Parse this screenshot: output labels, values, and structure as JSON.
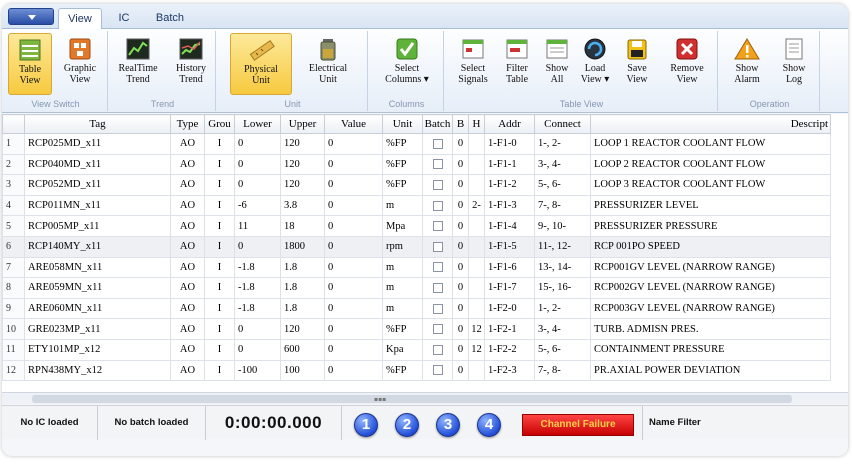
{
  "tabs": [
    "View",
    "IC",
    "Batch"
  ],
  "ribbon": {
    "groups": [
      {
        "label": "View Switch",
        "buttons": [
          {
            "label": "Table\nView",
            "icon": "table-view-icon"
          },
          {
            "label": "Graphic\nView",
            "icon": "graphic-view-icon"
          }
        ]
      },
      {
        "label": "Trend",
        "buttons": [
          {
            "label": "RealTime\nTrend",
            "icon": "realtime-trend-icon"
          },
          {
            "label": "History\nTrend",
            "icon": "history-trend-icon"
          }
        ]
      },
      {
        "label": "Unit",
        "buttons": [
          {
            "label": "Physical\nUnit",
            "icon": "ruler-icon"
          },
          {
            "label": "Electrical\nUnit",
            "icon": "battery-icon"
          }
        ]
      },
      {
        "label": "Columns",
        "buttons": [
          {
            "label": "Select\nColumns ▾",
            "icon": "checkmark-icon"
          }
        ]
      },
      {
        "label": "Table View",
        "buttons": [
          {
            "label": "Select\nSignals",
            "icon": "select-signals-icon"
          },
          {
            "label": "Filter\nTable",
            "icon": "filter-table-icon"
          },
          {
            "label": "Show\nAll",
            "icon": "show-all-icon"
          },
          {
            "label": "Load\nView ▾",
            "icon": "load-view-icon"
          },
          {
            "label": "Save\nView",
            "icon": "save-view-icon"
          },
          {
            "label": "Remove\nView",
            "icon": "remove-view-icon"
          }
        ]
      },
      {
        "label": "Operation",
        "buttons": [
          {
            "label": "Show\nAlarm",
            "icon": "alarm-icon"
          },
          {
            "label": "Show\nLog",
            "icon": "log-icon"
          }
        ]
      }
    ]
  },
  "table": {
    "headers": [
      "",
      "Tag",
      "Type",
      "Grou",
      "Lower",
      "Upper",
      "Value",
      "Unit",
      "Batch",
      "B",
      "H",
      "Addr",
      "Connect",
      "Descript"
    ],
    "rows": [
      [
        "1",
        "RCP025MD_x11",
        "AO",
        "I",
        "0",
        "120",
        "0",
        "%FP",
        "",
        "0",
        "",
        "1-F1-0",
        "1-, 2-",
        "LOOP 1 REACTOR COOLANT FLOW"
      ],
      [
        "2",
        "RCP040MD_x11",
        "AO",
        "I",
        "0",
        "120",
        "0",
        "%FP",
        "",
        "0",
        "",
        "1-F1-1",
        "3-, 4-",
        "LOOP 2 REACTOR COOLANT FLOW"
      ],
      [
        "3",
        "RCP052MD_x11",
        "AO",
        "I",
        "0",
        "120",
        "0",
        "%FP",
        "",
        "0",
        "",
        "1-F1-2",
        "5-, 6-",
        "LOOP 3 REACTOR COOLANT FLOW"
      ],
      [
        "4",
        "RCP011MN_x11",
        "AO",
        "I",
        "-6",
        "3.8",
        "0",
        "m",
        "",
        "0",
        "2-",
        "1-F1-3",
        "7-, 8-",
        "PRESSURIZER LEVEL"
      ],
      [
        "5",
        "RCP005MP_x11",
        "AO",
        "I",
        "11",
        "18",
        "0",
        "Mpa",
        "",
        "0",
        "",
        "1-F1-4",
        "9-, 10-",
        "PRESSURIZER PRESSURE"
      ],
      [
        "6",
        "RCP140MY_x11",
        "AO",
        "I",
        "0",
        "1800",
        "0",
        "rpm",
        "",
        "0",
        "",
        "1-F1-5",
        "11-, 12-",
        "RCP 001PO SPEED"
      ],
      [
        "7",
        "ARE058MN_x11",
        "AO",
        "I",
        "-1.8",
        "1.8",
        "0",
        "m",
        "",
        "0",
        "",
        "1-F1-6",
        "13-, 14-",
        "RCP001GV LEVEL (NARROW RANGE)"
      ],
      [
        "8",
        "ARE059MN_x11",
        "AO",
        "I",
        "-1.8",
        "1.8",
        "0",
        "m",
        "",
        "0",
        "",
        "1-F1-7",
        "15-, 16-",
        "RCP002GV LEVEL (NARROW RANGE)"
      ],
      [
        "9",
        "ARE060MN_x11",
        "AO",
        "I",
        "-1.8",
        "1.8",
        "0",
        "m",
        "",
        "0",
        "",
        "1-F2-0",
        "1-, 2-",
        "RCP003GV LEVEL (NARROW RANGE)"
      ],
      [
        "10",
        "GRE023MP_x11",
        "AO",
        "I",
        "0",
        "120",
        "0",
        "%FP",
        "",
        "0",
        "12",
        "1-F2-1",
        "3-, 4-",
        "TURB. ADMISN PRES."
      ],
      [
        "11",
        "ETY101MP_x12",
        "AO",
        "I",
        "0",
        "600",
        "0",
        "Kpa",
        "",
        "0",
        "12",
        "1-F2-2",
        "5-, 6-",
        "CONTAINMENT PRESSURE"
      ],
      [
        "12",
        "RPN438MY_x12",
        "AO",
        "I",
        "-100",
        "100",
        "0",
        "%FP",
        "",
        "0",
        "",
        "1-F2-3",
        "7-, 8-",
        "PR.AXIAL POWER DEVIATION"
      ]
    ]
  },
  "status": {
    "ic": "No IC loaded",
    "batch": "No batch loaded",
    "clock": "0:00:00.000",
    "channels": [
      "1",
      "2",
      "3",
      "4"
    ],
    "channel_failure": "Channel Failure",
    "name_filter": "Name Filter"
  },
  "colors": {
    "selected_button": "#f7c93f",
    "channel_button": "#2450d8",
    "failure": "#d40000"
  }
}
